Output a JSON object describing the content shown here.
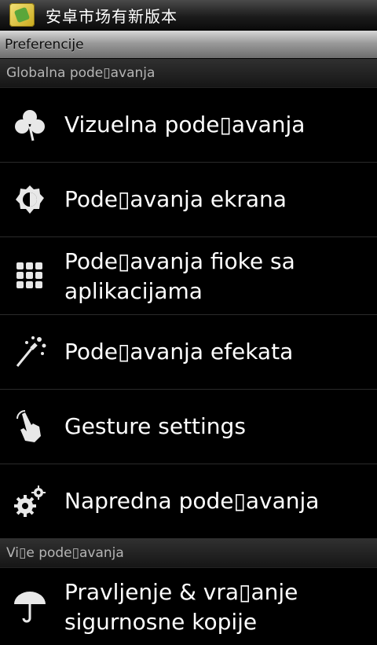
{
  "titlebar": {
    "app_title": "安卓市场有新版本"
  },
  "header": {
    "title": "Preferencije"
  },
  "sections": [
    {
      "header": "Globalna pode▯avanja"
    },
    {
      "header": "Vi▯e pode▯avanja"
    }
  ],
  "items": [
    {
      "label": "Vizuelna pode▯avanja",
      "icon": "clover-icon"
    },
    {
      "label": "Pode▯avanja ekrana",
      "icon": "brightness-icon"
    },
    {
      "label": "Pode▯avanja fioke sa aplikacijama",
      "icon": "app-grid-icon"
    },
    {
      "label": "Pode▯avanja efekata",
      "icon": "magic-wand-icon"
    },
    {
      "label": "Gesture settings",
      "icon": "gesture-hand-icon"
    },
    {
      "label": "Napredna pode▯avanja",
      "icon": "gears-icon"
    },
    {
      "label": "Pravljenje & vra▯anje sigurnosne kopije",
      "icon": "umbrella-icon"
    }
  ]
}
